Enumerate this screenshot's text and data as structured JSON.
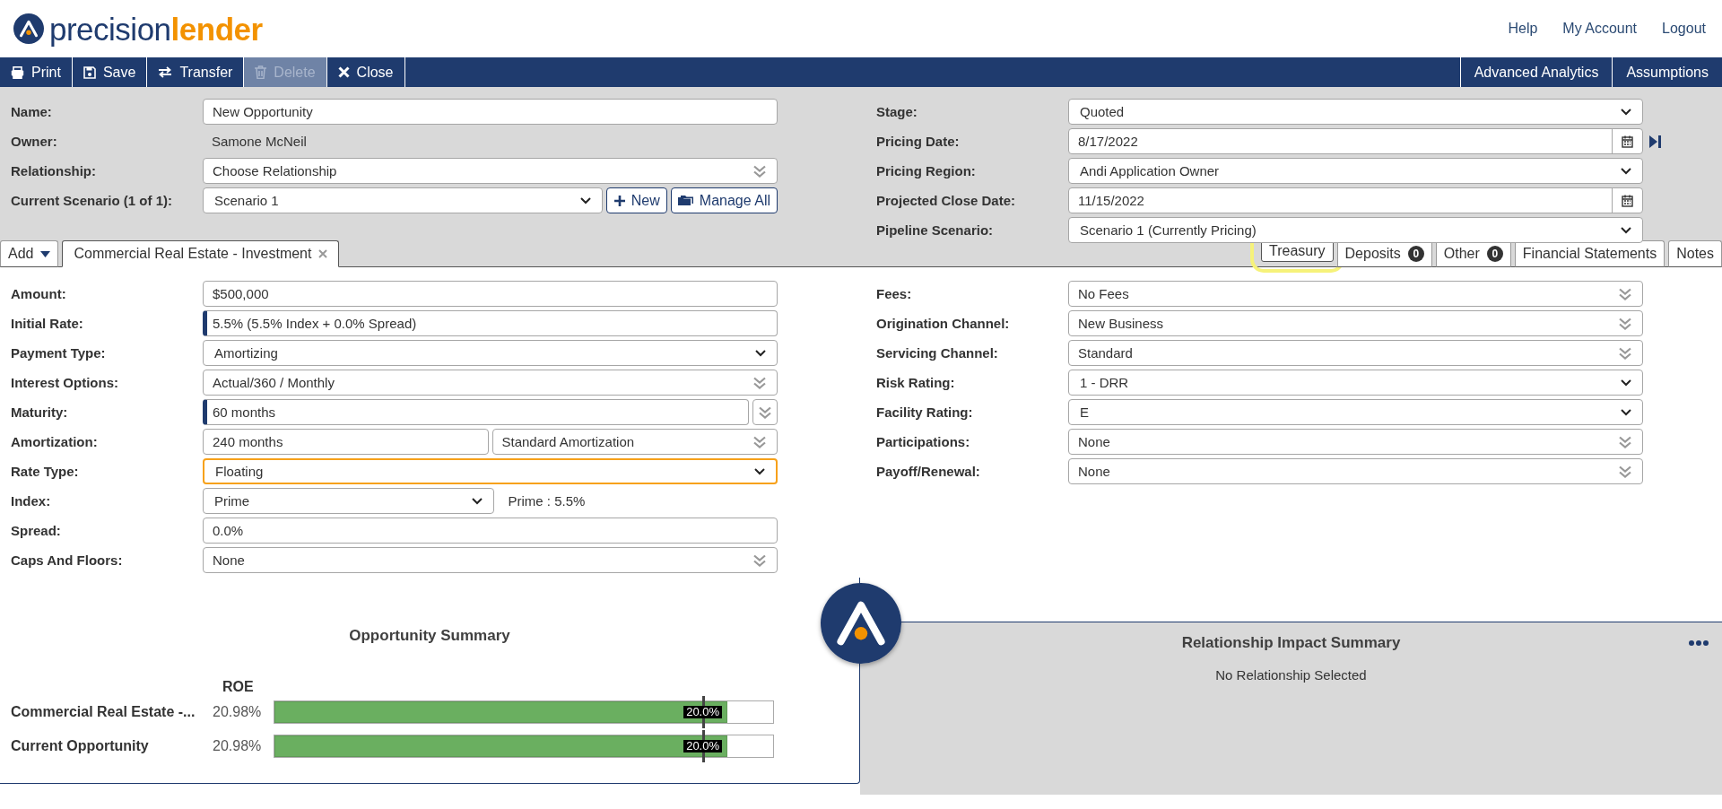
{
  "logo": {
    "part_1": "precision",
    "part_2": "lender"
  },
  "header_links": [
    "Help",
    "My Account",
    "Logout"
  ],
  "toolbar": {
    "left": [
      {
        "label": "Print",
        "disabled": false
      },
      {
        "label": "Save",
        "disabled": false
      },
      {
        "label": "Transfer",
        "disabled": false
      },
      {
        "label": "Delete",
        "disabled": true
      },
      {
        "label": "Close",
        "disabled": false
      }
    ],
    "right": [
      {
        "label": "Advanced Analytics"
      },
      {
        "label": "Assumptions"
      }
    ]
  },
  "deal_form": {
    "left": [
      {
        "label": "Name:",
        "controls": [
          {
            "kind": "text",
            "value": "New Opportunity",
            "accent": false
          }
        ]
      },
      {
        "label": "Owner:",
        "controls": [
          {
            "kind": "static",
            "value": "Samone McNeil"
          }
        ]
      },
      {
        "label": "Relationship:",
        "controls": [
          {
            "kind": "multi",
            "value": "Choose Relationship"
          }
        ]
      },
      {
        "label": "Current Scenario (1 of 1):",
        "controls": [
          {
            "kind": "select",
            "value": "Scenario 1",
            "focused": false
          },
          {
            "kind": "button",
            "label": "New"
          },
          {
            "kind": "button",
            "label": "Manage All"
          }
        ]
      }
    ],
    "right": [
      {
        "label": "Stage:",
        "controls": [
          {
            "kind": "select",
            "value": "Quoted",
            "focused": false
          }
        ]
      },
      {
        "label": "Pricing Date:",
        "controls": [
          {
            "kind": "date",
            "value": "8/17/2022"
          },
          {
            "kind": "jump"
          }
        ]
      },
      {
        "label": "Pricing Region:",
        "controls": [
          {
            "kind": "select",
            "value": "Andi Application Owner",
            "focused": false
          }
        ]
      },
      {
        "label": "Projected Close Date:",
        "controls": [
          {
            "kind": "date",
            "value": "11/15/2022"
          }
        ]
      },
      {
        "label": "Pipeline Scenario:",
        "controls": [
          {
            "kind": "select",
            "value": "Scenario 1 (Currently Pricing)",
            "focused": false
          }
        ]
      }
    ]
  },
  "tabs": {
    "add_menu": "Add",
    "products": [
      {
        "label": "Commercial Real Estate - Investment",
        "selected": true
      }
    ],
    "sections": [
      {
        "label": "Treasury",
        "selected": false,
        "highlighted": true
      },
      {
        "label": "Deposits",
        "count": "0",
        "selected": false,
        "highlighted": false
      },
      {
        "label": "Other",
        "count": "0",
        "selected": false,
        "highlighted": false
      },
      {
        "label": "Financial Statements",
        "selected": false,
        "highlighted": false
      },
      {
        "label": "Notes",
        "selected": false,
        "highlighted": false
      }
    ]
  },
  "product_form": {
    "left": [
      {
        "label": "Amount:",
        "controls": [
          {
            "kind": "text",
            "value": "$500,000",
            "accent": false
          }
        ]
      },
      {
        "label": "Initial Rate:",
        "controls": [
          {
            "kind": "text",
            "value": "5.5% (5.5% Index + 0.0% Spread)",
            "accent": true
          }
        ]
      },
      {
        "label": "Payment Type:",
        "controls": [
          {
            "kind": "select",
            "value": "Amortizing",
            "focused": false
          }
        ]
      },
      {
        "label": "Interest Options:",
        "controls": [
          {
            "kind": "multi",
            "value": "Actual/360 / Monthly"
          }
        ]
      },
      {
        "label": "Maturity:",
        "controls": [
          {
            "kind": "text",
            "value": "60 months",
            "accent": true
          },
          {
            "kind": "toggle"
          }
        ]
      },
      {
        "label": "Amortization:",
        "controls": [
          {
            "kind": "text",
            "value": "240 months",
            "accent": false
          },
          {
            "kind": "multi",
            "value": "Standard Amortization"
          }
        ]
      },
      {
        "label": "Rate Type:",
        "controls": [
          {
            "kind": "select",
            "value": "Floating",
            "focused": true
          }
        ]
      },
      {
        "label": "Index:",
        "controls": [
          {
            "kind": "select",
            "value": "Prime",
            "focused": false
          },
          {
            "kind": "note",
            "value": "Prime : 5.5%"
          }
        ]
      },
      {
        "label": "Spread:",
        "controls": [
          {
            "kind": "text",
            "value": "0.0%",
            "accent": false
          }
        ]
      },
      {
        "label": "Caps And Floors:",
        "controls": [
          {
            "kind": "multi",
            "value": "None"
          }
        ]
      }
    ],
    "right": [
      {
        "label": "Fees:",
        "controls": [
          {
            "kind": "multi",
            "value": "No Fees"
          }
        ]
      },
      {
        "label": "Origination Channel:",
        "controls": [
          {
            "kind": "multi",
            "value": "New Business"
          }
        ]
      },
      {
        "label": "Servicing Channel:",
        "controls": [
          {
            "kind": "multi",
            "value": "Standard"
          }
        ]
      },
      {
        "label": "Risk Rating:",
        "controls": [
          {
            "kind": "select",
            "value": "1 - DRR",
            "focused": false
          }
        ]
      },
      {
        "label": "Facility Rating:",
        "controls": [
          {
            "kind": "select",
            "value": "E",
            "focused": false
          }
        ]
      },
      {
        "label": "Participations:",
        "controls": [
          {
            "kind": "multi",
            "value": "None"
          }
        ]
      },
      {
        "label": "Payoff/Renewal:",
        "controls": [
          {
            "kind": "multi",
            "value": "None"
          }
        ]
      }
    ]
  },
  "opportunity_summary": {
    "title": "Opportunity Summary",
    "metric_heading": "ROE",
    "rows": [
      {
        "label": "Commercial Real Estate -...",
        "value": "20.98%",
        "level": 0.905,
        "target": {
          "label": "20.0%",
          "level": 0.86
        }
      },
      {
        "label": "Current Opportunity",
        "value": "20.98%",
        "level": 0.905,
        "target": {
          "label": "20.0%",
          "level": 0.86
        }
      }
    ]
  },
  "relationship_impact_summary": {
    "title": "Relationship Impact Summary",
    "message": "No Relationship Selected"
  }
}
